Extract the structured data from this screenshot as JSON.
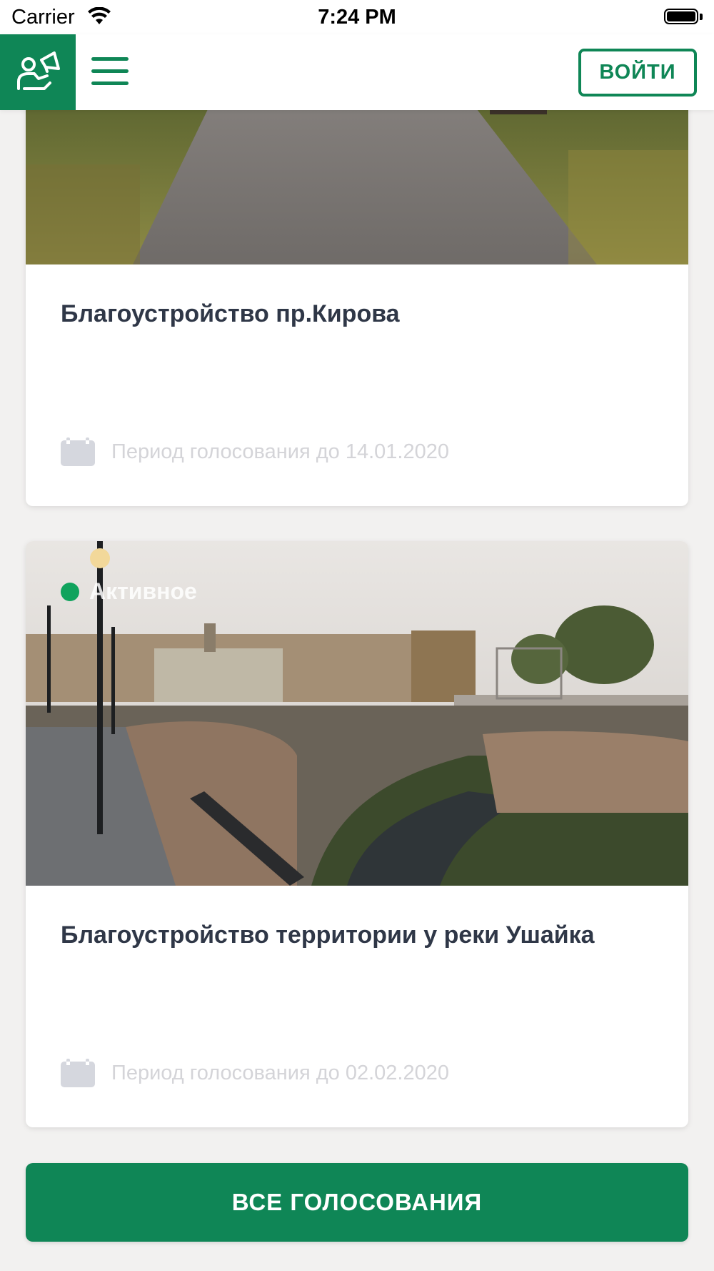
{
  "status_bar": {
    "carrier": "Carrier",
    "time": "7:24 PM"
  },
  "header": {
    "logo_icon": "megaphone-people-icon",
    "menu_icon": "hamburger-menu-icon",
    "login_label": "ВОЙТИ"
  },
  "cards": [
    {
      "title": "Благоустройство пр.Кирова",
      "period": "Период голосования до 14.01.2020",
      "period_icon": "calendar-icon"
    },
    {
      "badge": "Активное",
      "title": "Благоустройство территории у реки Ушайка",
      "period": "Период голосования до 02.02.2020",
      "period_icon": "calendar-icon"
    }
  ],
  "footer": {
    "all_votes_label": "ВСЕ ГОЛОСОВАНИЯ"
  },
  "colors": {
    "brand": "#0f8656",
    "active_dot": "#10a35d",
    "title": "#2f3747",
    "muted": "#d4d4d8"
  }
}
